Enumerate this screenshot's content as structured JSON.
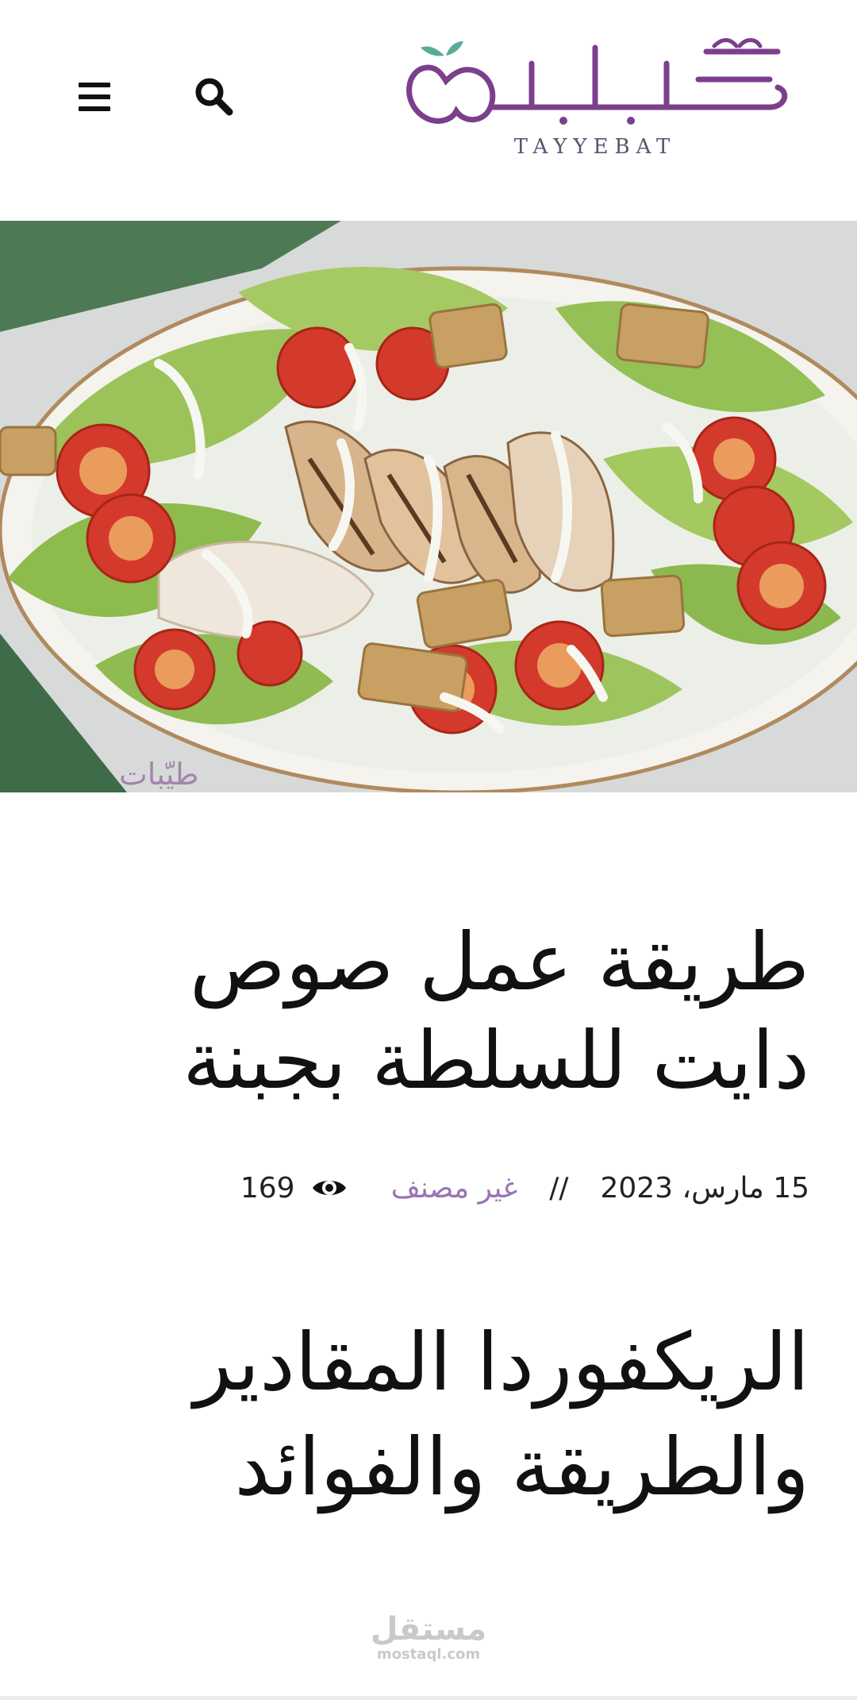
{
  "header": {
    "logo_arabic": "طيّبات",
    "logo_latin": "TAYYEBAT",
    "menu_icon": "hamburger-menu-icon",
    "search_icon": "search-icon"
  },
  "hero": {
    "image": "caesar-salad-photo",
    "watermark": "طيّبات"
  },
  "article": {
    "title": "طريقة عمل صوص دايت للسلطة بجبنة",
    "date": "15 مارس، 2023",
    "separator": "//",
    "category": "غير مصنف",
    "views": "169",
    "views_icon": "eye-icon"
  },
  "related": {
    "heading": "الريكفوردا المقادير والطريقة والفوائد"
  },
  "footer_watermark": {
    "arabic": "مستقل",
    "latin": "mostaql.com"
  },
  "colors": {
    "category": "#9a74b4",
    "logo_purple": "#7b3f8c",
    "logo_teal": "#5aaa9a"
  }
}
